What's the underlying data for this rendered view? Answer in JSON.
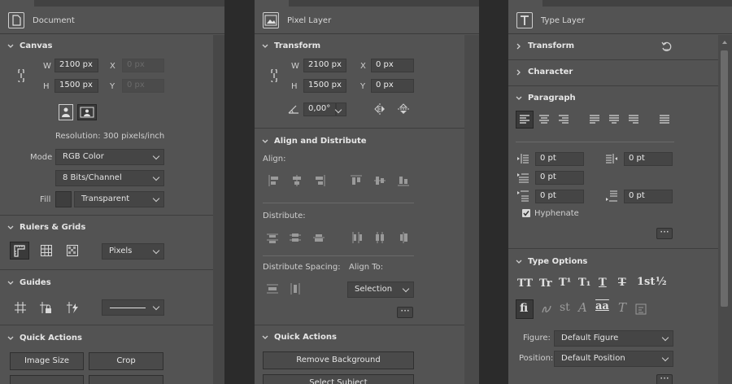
{
  "panels": {
    "document": {
      "title": "Document",
      "canvas": {
        "header": "Canvas",
        "w_label": "W",
        "w_value": "2100 px",
        "h_label": "H",
        "h_value": "1500 px",
        "x_label": "X",
        "x_placeholder": "0 px",
        "y_label": "Y",
        "y_placeholder": "0 px",
        "resolution": "Resolution: 300 pixels/inch",
        "mode_label": "Mode",
        "mode_value": "RGB Color",
        "bits_value": "8 Bits/Channel",
        "fill_label": "Fill",
        "fill_value": "Transparent"
      },
      "rulers": {
        "header": "Rulers & Grids",
        "units_value": "Pixels"
      },
      "guides": {
        "header": "Guides"
      },
      "quick_actions": {
        "header": "Quick Actions",
        "image_size": "Image Size",
        "crop": "Crop"
      }
    },
    "pixel": {
      "title": "Pixel Layer",
      "transform": {
        "header": "Transform",
        "w_label": "W",
        "w_value": "2100 px",
        "h_label": "H",
        "h_value": "1500 px",
        "x_label": "X",
        "x_value": "0 px",
        "y_label": "Y",
        "y_value": "0 px",
        "angle_value": "0,00°"
      },
      "align": {
        "header": "Align and Distribute",
        "align_label": "Align:",
        "distribute_label": "Distribute:",
        "spacing_label": "Distribute Spacing:",
        "align_to_label": "Align To:",
        "align_to_value": "Selection"
      },
      "quick_actions": {
        "header": "Quick Actions",
        "remove_bg": "Remove Background",
        "select_subject": "Select Subject"
      }
    },
    "type": {
      "title": "Type Layer",
      "transform_header": "Transform",
      "character_header": "Character",
      "paragraph": {
        "header": "Paragraph",
        "indent_left": "0 pt",
        "indent_right": "0 pt",
        "indent_first": "0 pt",
        "space_before": "0 pt",
        "space_after": "0 pt",
        "hyphenate_label": "Hyphenate"
      },
      "type_options": {
        "header": "Type Options",
        "figure_label": "Figure:",
        "figure_value": "Default Figure",
        "position_label": "Position:",
        "position_value": "Default Position",
        "glyph_tt": "TT",
        "glyph_tr": "Tr",
        "glyph_sup": "T¹",
        "glyph_sub": "T₁",
        "glyph_under": "T",
        "glyph_strike": "T",
        "glyph_ordinal": "1st",
        "glyph_fraction": "½",
        "glyph_fi": "fi",
        "glyph_st": "st",
        "glyph_swash": "A",
        "glyph_aa": "aa",
        "glyph_titling": "T"
      }
    }
  },
  "colors": {
    "panel_bg": "#535353",
    "gutter": "#2b2b2b",
    "field_bg": "#454545",
    "text": "#d6d6d6"
  }
}
